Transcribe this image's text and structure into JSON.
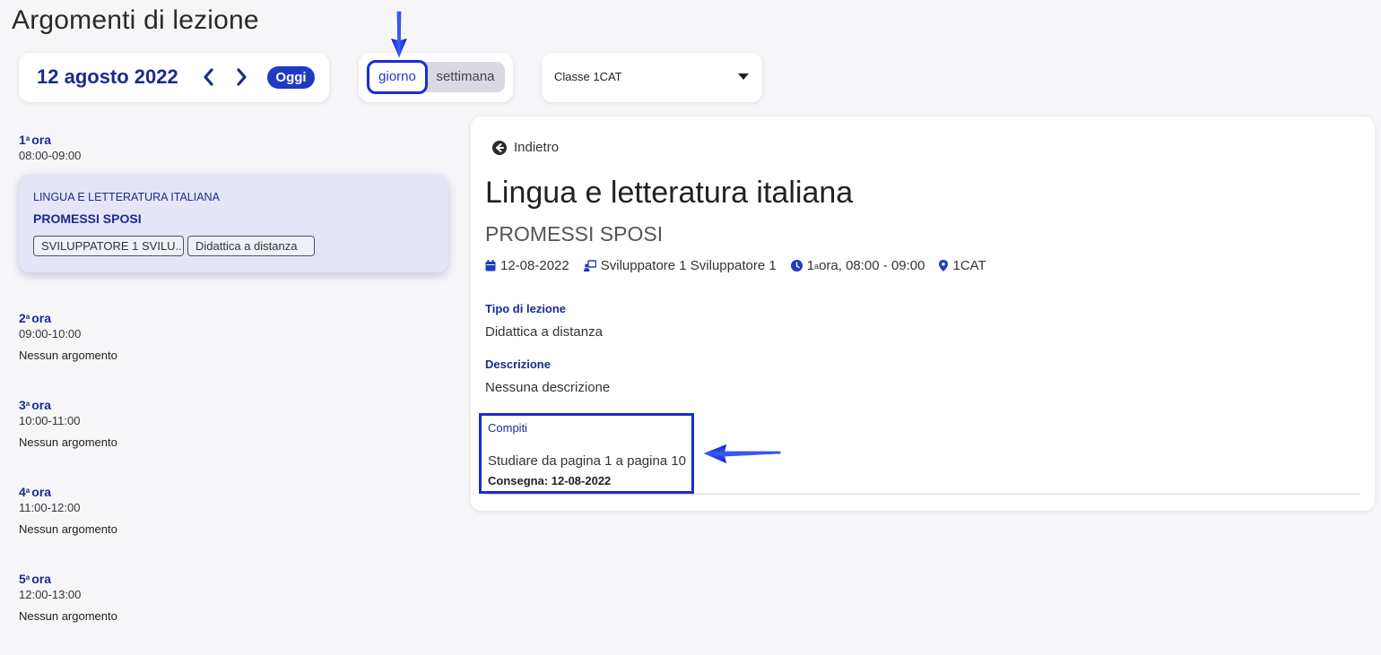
{
  "page": {
    "title": "Argomenti di lezione"
  },
  "date_nav": {
    "date": "12 agosto 2022",
    "prev": "previous-day",
    "next": "next-day",
    "today": "Oggi"
  },
  "view_toggle": {
    "day": "giorno",
    "week": "settimana",
    "selected": "giorno"
  },
  "class_select": {
    "value": "Classe 1CAT"
  },
  "slots": [
    {
      "num": "1",
      "label": "ora",
      "time": "08:00-09:00"
    },
    {
      "num": "2",
      "label": "ora",
      "time": "09:00-10:00",
      "empty": "Nessun argomento"
    },
    {
      "num": "3",
      "label": "ora",
      "time": "10:00-11:00",
      "empty": "Nessun argomento"
    },
    {
      "num": "4",
      "label": "ora",
      "time": "11:00-12:00",
      "empty": "Nessun argomento"
    },
    {
      "num": "5",
      "label": "ora",
      "time": "12:00-13:00",
      "empty": "Nessun argomento"
    }
  ],
  "lesson_card": {
    "subject": "LINGUA E LETTERATURA ITALIANA",
    "topic": "PROMESSI SPOSI",
    "tags": [
      "SVILUPPATORE 1 SVILU...",
      "Didattica a distanza"
    ]
  },
  "detail": {
    "back": "Indietro",
    "title": "Lingua e letteratura italiana",
    "topic": "PROMESSI SPOSI",
    "meta": {
      "date": "12-08-2022",
      "teacher": "Sviluppatore 1 Sviluppatore 1",
      "hour_num": "1",
      "hour_sup": "a",
      "hour_rest": " ora, 08:00 - 09:00",
      "class": "1CAT"
    },
    "type_label": "Tipo di lezione",
    "type_value": "Didattica a distanza",
    "desc_label": "Descrizione",
    "desc_value": "Nessuna descrizione",
    "homework_label": "Compiti",
    "homework_text": "Studiare da pagina 1 a pagina 10",
    "homework_due": "Consegna: 12-08-2022"
  },
  "colors": {
    "accent": "#1d3bc4",
    "primary_text": "#1b2a8f",
    "annotation": "#1a2bd6",
    "background": "#f6f6f9"
  },
  "icons": [
    "chevron-left-icon",
    "chevron-right-icon",
    "caret-down-icon",
    "back-arrow-icon",
    "calendar-icon",
    "teacher-icon",
    "clock-icon",
    "location-icon"
  ]
}
